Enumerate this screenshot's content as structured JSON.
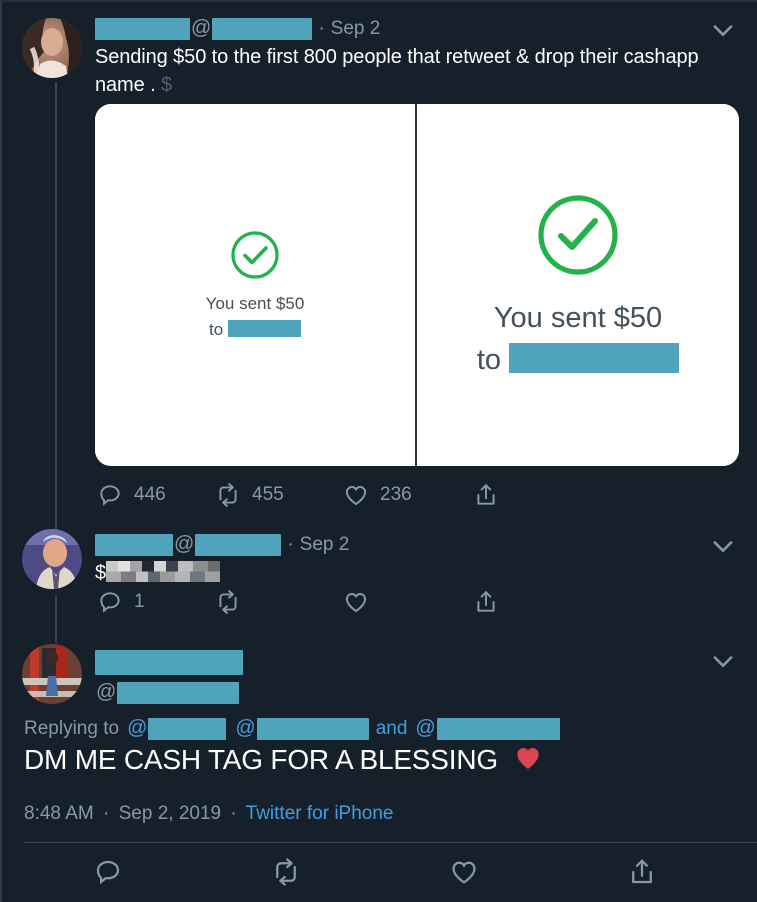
{
  "theme": {
    "background": "#15202b",
    "text_primary": "#ffffff",
    "text_secondary": "#8899a6",
    "link_blue": "#3f9fe0",
    "redaction_teal": "#4fa3ba",
    "divider": "#38444d",
    "success_green": "#21b34a",
    "heart_red": "#de4452"
  },
  "tweets": [
    {
      "id": "tweet-1",
      "display_name": "[redacted]",
      "handle_prefix": "@",
      "handle": "[redacted]",
      "separator": "·",
      "date": "Sep 2",
      "text": "Sending $50 to the first 800 people that retweet & drop their cashapp name . ",
      "trailing_glyph": "$",
      "chevron": "chevron-down-icon",
      "media": {
        "left": {
          "status_icon": "check-circle-icon",
          "line1": "You sent $50",
          "line2_prefix": "to",
          "line2_redacted": "[redacted]"
        },
        "right": {
          "status_icon": "check-circle-icon",
          "line1": "You sent $50",
          "line2_prefix": "to",
          "line2_redacted": "[redacted]"
        }
      },
      "actions": {
        "reply": {
          "icon": "reply-icon",
          "count": "446"
        },
        "retweet": {
          "icon": "retweet-icon",
          "count": "455"
        },
        "like": {
          "icon": "heart-icon",
          "count": "236"
        },
        "share": {
          "icon": "share-icon",
          "count": ""
        }
      }
    },
    {
      "id": "tweet-2",
      "display_name": "[redacted]",
      "handle_prefix": "@",
      "handle": "[redacted]",
      "separator": "·",
      "date": "Sep 2",
      "text_prefix": "$",
      "text_blurred": "[pixelated cashtag]",
      "chevron": "chevron-down-icon",
      "actions": {
        "reply": {
          "icon": "reply-icon",
          "count": "1"
        },
        "retweet": {
          "icon": "retweet-icon",
          "count": ""
        },
        "like": {
          "icon": "heart-icon",
          "count": ""
        },
        "share": {
          "icon": "share-icon",
          "count": ""
        }
      }
    },
    {
      "id": "tweet-3",
      "display_name": "[redacted]",
      "handle_prefix": "@",
      "handle": "[redacted]",
      "chevron": "chevron-down-icon",
      "replying_to": {
        "label": "Replying to",
        "at": "@",
        "conjunction": "and"
      },
      "text": "DM ME CASH TAG FOR A BLESSING",
      "emoji": "red-heart-emoji",
      "meta": {
        "time": "8:48 AM",
        "sep1": "·",
        "date": "Sep 2, 2019",
        "sep2": "·",
        "source": "Twitter for iPhone"
      },
      "actions": {
        "reply": {
          "icon": "reply-icon",
          "count": ""
        },
        "retweet": {
          "icon": "retweet-icon",
          "count": ""
        },
        "like": {
          "icon": "heart-icon",
          "count": ""
        },
        "share": {
          "icon": "share-icon",
          "count": ""
        }
      }
    }
  ]
}
